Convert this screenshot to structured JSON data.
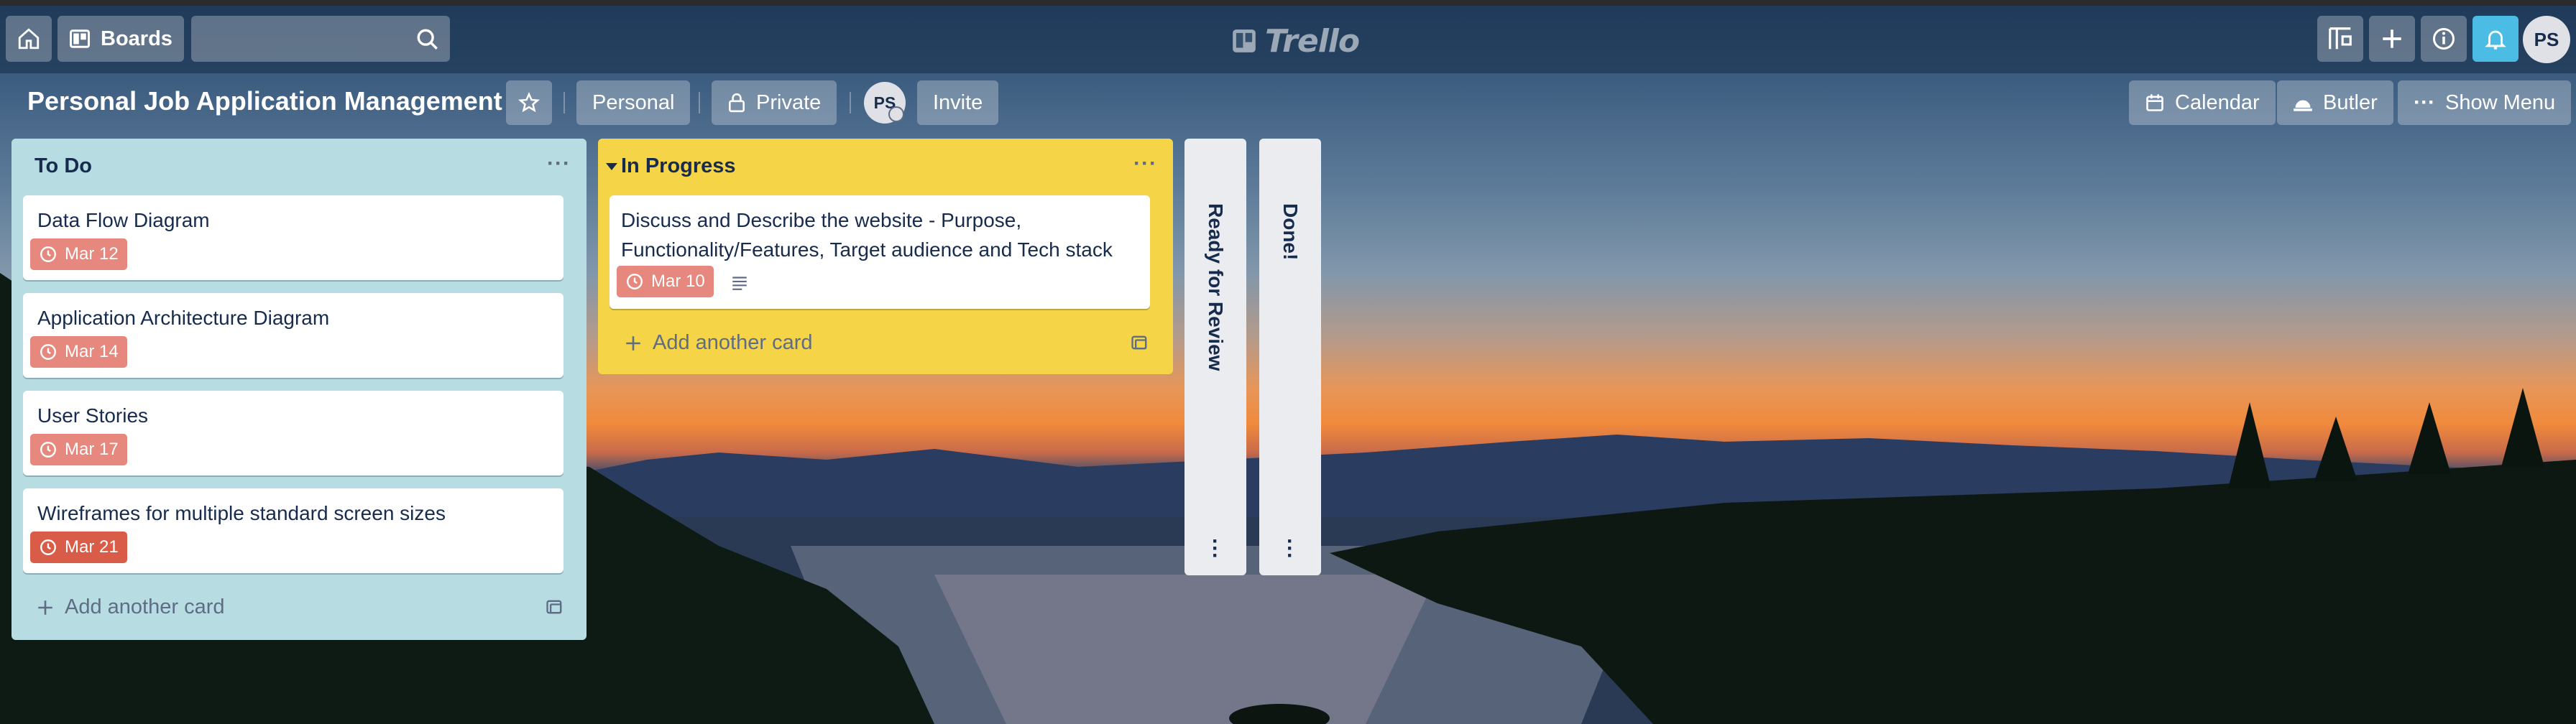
{
  "header": {
    "boards_label": "Boards",
    "search_value": "",
    "logo_text": "Trello",
    "avatar_initials": "PS",
    "icons": [
      "home-icon",
      "board-icon",
      "search-icon",
      "board-template-icon",
      "plus-icon",
      "info-icon",
      "bell-icon"
    ]
  },
  "board": {
    "title": "Personal Job Application Management",
    "team_label": "Personal",
    "visibility_label": "Private",
    "member_initials": "PS",
    "invite_label": "Invite",
    "calendar_label": "Calendar",
    "butler_label": "Butler",
    "show_menu_label": "Show Menu",
    "menu_dots": "···"
  },
  "lists": [
    {
      "title": "To Do",
      "background": "#b7dde3",
      "cards": [
        {
          "title": "Data Flow Diagram",
          "due": "Mar 12",
          "due_color": "#e6887e"
        },
        {
          "title": "Application Architecture Diagram",
          "due": "Mar 14",
          "due_color": "#e6887e"
        },
        {
          "title": "User Stories",
          "due": "Mar 17",
          "due_color": "#e6887e"
        },
        {
          "title": "Wireframes for multiple standard screen sizes",
          "due": "Mar 21",
          "due_color": "#d85c48"
        }
      ],
      "add_card_label": "Add another card"
    },
    {
      "title": "In Progress",
      "background": "#f5d547",
      "cards": [
        {
          "title": "Discuss and Describe the website - Purpose, Functionality/Features, Target audience and Tech stack",
          "due": "Mar 10",
          "due_color": "#e6887e",
          "has_description": true
        }
      ],
      "add_card_label": "Add another card"
    },
    {
      "title": "Ready for Review",
      "collapsed": true
    },
    {
      "title": "Done!",
      "collapsed": true
    }
  ],
  "colors": {
    "header_accent": "#4bbde5",
    "card_text": "#172b4d"
  }
}
